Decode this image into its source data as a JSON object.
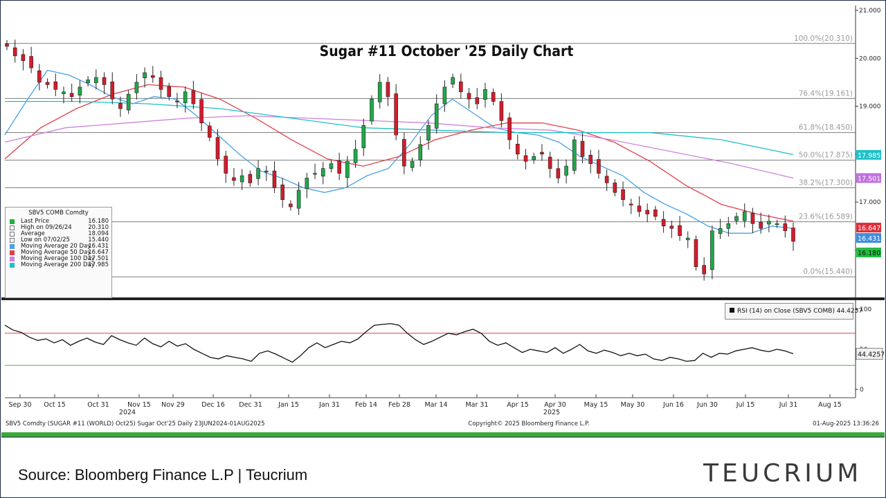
{
  "chart_data": {
    "type": "candlestick",
    "title": "Sugar #11 October '25 Daily Chart",
    "price_axis": {
      "ylim": [
        15.1,
        21.0
      ],
      "ticks": [
        "21.000",
        "20.000",
        "19.000",
        "18.000",
        "17.000",
        "16.000"
      ]
    },
    "x_ticks": [
      "Sep 30",
      "Oct 15",
      "Oct 31",
      "Nov 15",
      "Nov 29",
      "Dec 16",
      "Dec 31",
      "Jan 15",
      "Jan 31",
      "Feb 14",
      "Feb 28",
      "Mar 14",
      "Mar 31",
      "Apr 15",
      "Apr 30",
      "May 15",
      "May 30",
      "Jun 16",
      "Jun 30",
      "Jul 15",
      "Jul 31",
      "Aug 15"
    ],
    "year_labels": [
      "2024",
      "2025"
    ],
    "close_path": [
      20.25,
      20.05,
      19.95,
      19.8,
      19.5,
      19.45,
      19.35,
      19.3,
      19.2,
      19.4,
      19.55,
      19.6,
      19.45,
      19.15,
      18.95,
      19.25,
      19.5,
      19.7,
      19.6,
      19.35,
      19.2,
      19.1,
      19.3,
      19.05,
      18.65,
      18.35,
      17.9,
      17.6,
      17.45,
      17.55,
      17.4,
      17.7,
      17.65,
      17.3,
      17.05,
      16.9,
      17.25,
      17.5,
      17.6,
      17.7,
      17.8,
      17.6,
      17.85,
      18.1,
      18.6,
      19.15,
      19.5,
      19.2,
      18.4,
      17.75,
      17.85,
      18.2,
      18.6,
      19.05,
      19.4,
      19.6,
      19.3,
      19.15,
      19.05,
      19.35,
      19.1,
      18.7,
      18.3,
      18.0,
      17.85,
      17.95,
      18.0,
      17.7,
      17.5,
      17.75,
      18.3,
      17.95,
      17.8,
      17.6,
      17.4,
      17.2,
      17.05,
      16.95,
      16.8,
      16.75,
      16.7,
      16.5,
      16.45,
      16.3,
      16.25,
      15.65,
      15.5,
      16.4,
      16.45,
      16.55,
      16.7,
      16.8,
      16.55,
      16.45,
      16.6,
      16.55,
      16.4,
      16.18
    ],
    "fib_levels": [
      {
        "label": "100.0%(20.310)",
        "value": 20.31
      },
      {
        "label": "76.4%(19.161)",
        "value": 19.161
      },
      {
        "label": "61.8%(18.450)",
        "value": 18.45
      },
      {
        "label": "50.0%(17.875)",
        "value": 17.875
      },
      {
        "label": "38.2%(17.300)",
        "value": 17.3
      },
      {
        "label": "23.6%(16.589)",
        "value": 16.589
      },
      {
        "label": "0.0%(15.440)",
        "value": 15.44
      }
    ],
    "series": [
      {
        "name": "Moving Average 20 Day",
        "color": "#4aa0e6",
        "values": [
          18.4,
          19.1,
          19.75,
          19.65,
          19.45,
          19.2,
          19.05,
          19.2,
          19.15,
          18.8,
          18.4,
          18.0,
          17.65,
          17.5,
          17.3,
          17.2,
          17.3,
          17.55,
          17.7,
          18.2,
          18.8,
          19.15,
          18.85,
          18.55,
          18.45,
          18.4,
          18.25,
          17.95,
          17.75,
          17.55,
          17.2,
          16.95,
          16.75,
          16.5,
          16.35,
          16.35,
          16.5,
          16.45
        ]
      },
      {
        "name": "Moving Average 50 Day",
        "color": "#e0404a",
        "values": [
          17.9,
          18.55,
          18.95,
          19.25,
          19.45,
          19.4,
          19.15,
          18.75,
          18.3,
          17.9,
          17.75,
          17.95,
          18.3,
          18.5,
          18.65,
          18.65,
          18.5,
          18.25,
          17.85,
          17.35,
          16.95,
          16.75,
          16.6
        ]
      },
      {
        "name": "Moving Average 100 Day",
        "color": "#d080e0",
        "values": [
          18.25,
          18.55,
          18.65,
          18.75,
          18.8,
          18.75,
          18.7,
          18.65,
          18.55,
          18.5,
          18.3,
          18.05,
          17.8,
          17.5
        ]
      },
      {
        "name": "Moving Average 200 Day",
        "color": "#20c0c8",
        "values": [
          19.1,
          19.1,
          19.05,
          18.95,
          18.75,
          18.55,
          18.5,
          18.45,
          18.45,
          18.45,
          18.3,
          17.99
        ]
      }
    ],
    "right_labels": [
      {
        "text": "17.985",
        "color": "#20c0c8",
        "value": 17.985
      },
      {
        "text": "17.501",
        "color": "#c070e0",
        "value": 17.501
      },
      {
        "text": "16.647",
        "color": "#e0303c",
        "value": 16.647
      },
      {
        "text": "16.431",
        "color": "#3a8fe0",
        "value": 16.431
      },
      {
        "text": "16.180",
        "color": "#20c040",
        "value": 16.18
      }
    ],
    "rsi": {
      "label": "RSI (14)  on Close (SBV5 COMB) 44.4257",
      "current": "44.4257",
      "ticks": [
        "100",
        "50",
        "0"
      ],
      "overbought": 70,
      "oversold": 30,
      "values": [
        80,
        74,
        71,
        65,
        61,
        63,
        58,
        62,
        55,
        60,
        64,
        59,
        56,
        67,
        62,
        58,
        55,
        64,
        57,
        53,
        60,
        54,
        57,
        50,
        45,
        40,
        38,
        42,
        40,
        38,
        35,
        45,
        48,
        44,
        39,
        34,
        42,
        52,
        58,
        52,
        56,
        60,
        58,
        63,
        72,
        80,
        81,
        82,
        80,
        70,
        62,
        56,
        60,
        65,
        70,
        68,
        72,
        75,
        70,
        60,
        55,
        58,
        52,
        46,
        50,
        48,
        46,
        52,
        45,
        50,
        56,
        48,
        45,
        49,
        46,
        42,
        45,
        42,
        44,
        38,
        36,
        40,
        38,
        35,
        36,
        45,
        40,
        45,
        44,
        48,
        50,
        52,
        49,
        47,
        50,
        48,
        44.4
      ]
    },
    "bottom_left": "SBV5 Comdty (SUGAR #11 (WORLD) Oct25) Sugar Oct'25  Daily 23JUN2024-01AUG2025",
    "bottom_center": "Copyright© 2025 Bloomberg Finance L.P.",
    "bottom_right": "01-Aug-2025 13:36:26"
  },
  "info_box": {
    "title": "SBV5 COMB Comdty",
    "rows": [
      {
        "label": "Last Price",
        "value": "16.180",
        "color": "#20b040"
      },
      {
        "label": "High on 09/26/24",
        "value": "20.310",
        "color": "none"
      },
      {
        "label": "Average",
        "value": "18.094",
        "color": "none"
      },
      {
        "label": "Low on 07/02/25",
        "value": "15.440",
        "color": "none"
      },
      {
        "label": "Moving Average 20 Day",
        "value": "16.431",
        "color": "#4aa0e6"
      },
      {
        "label": "Moving Average 50 Day",
        "value": "16.647",
        "color": "#e0404a"
      },
      {
        "label": "Moving Average 100 Day",
        "value": "17.501",
        "color": "#d080e0"
      },
      {
        "label": "Moving Average 200 Day",
        "value": "17.985",
        "color": "#20c0c8"
      }
    ]
  },
  "footer": {
    "source": "Source: Bloomberg Finance L.P | Teucrium",
    "logo": "TEUCRIUM"
  }
}
